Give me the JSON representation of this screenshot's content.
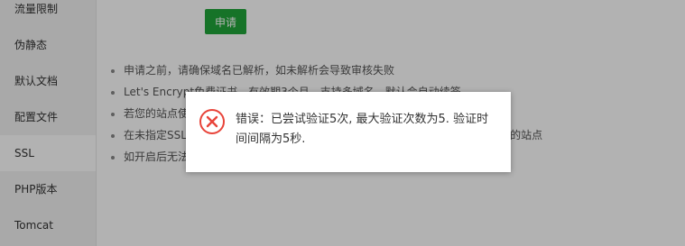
{
  "sidebar": {
    "items": [
      {
        "label": "流量限制"
      },
      {
        "label": "伪静态"
      },
      {
        "label": "默认文档"
      },
      {
        "label": "配置文件"
      },
      {
        "label": "SSL"
      },
      {
        "label": "PHP版本"
      },
      {
        "label": "Tomcat"
      }
    ],
    "active": "SSL"
  },
  "main": {
    "apply_button": "申请",
    "notes": [
      "申请之前，请确保域名已解析，如未解析会导致审核失败",
      "Let's Encrypt免费证书，有效期3个月，支持多域名。默认会自动续签",
      "若您的站点使用了CDN或301重定向会导致续签失败",
      "在未指定SSL默认站点时，未开启SSL的站点使用HTTPS会直接访问到已开启SSL的站点",
      "如开启后无法使用HTTPS访问，请检查安全组是否正确放行443端口"
    ]
  },
  "dialog": {
    "icon": "error-circle-x-icon",
    "message": "错误：已尝试验证5次, 最大验证次数为5. 验证时间间隔为5秒."
  },
  "colors": {
    "accent": "#20a53a",
    "error": "#e8443a",
    "overlay": "rgba(0,0,0,0.3)"
  }
}
